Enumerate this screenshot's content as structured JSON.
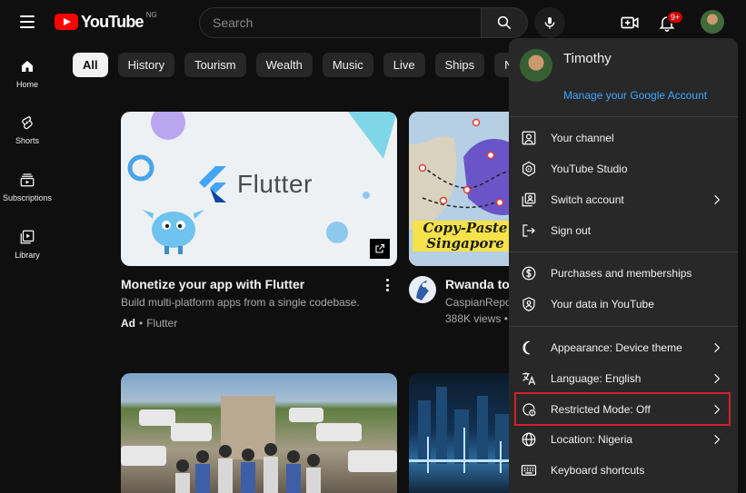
{
  "header": {
    "logo_text": "YouTube",
    "region": "NG",
    "search_placeholder": "Search",
    "notification_count": "9+"
  },
  "leftnav": [
    {
      "label": "Home",
      "icon": "home-icon"
    },
    {
      "label": "Shorts",
      "icon": "shorts-icon"
    },
    {
      "label": "Subscriptions",
      "icon": "subscriptions-icon"
    },
    {
      "label": "Library",
      "icon": "library-icon"
    }
  ],
  "chips": [
    "All",
    "History",
    "Tourism",
    "Wealth",
    "Music",
    "Live",
    "Ships",
    "News"
  ],
  "videos": [
    {
      "title": "Monetize your app with Flutter",
      "description": "Build multi-platform apps from a single codebase.",
      "ad_label": "Ad",
      "advertiser": "Flutter",
      "thumb_word": "Flutter"
    },
    {
      "title": "Rwanda to l",
      "channel": "CaspianRepo",
      "views": "388K views •",
      "thumb_caption": "Copy-Paste Singapore"
    }
  ],
  "account_menu": {
    "name": "Timothy",
    "manage_link": "Manage your Google Account",
    "groups": [
      [
        {
          "label": "Your channel",
          "icon": "account-box-icon",
          "chevron": false
        },
        {
          "label": "YouTube Studio",
          "icon": "studio-icon",
          "chevron": false
        },
        {
          "label": "Switch account",
          "icon": "switch-account-icon",
          "chevron": true
        },
        {
          "label": "Sign out",
          "icon": "sign-out-icon",
          "chevron": false
        }
      ],
      [
        {
          "label": "Purchases and memberships",
          "icon": "dollar-icon",
          "chevron": false
        },
        {
          "label": "Your data in YouTube",
          "icon": "shield-user-icon",
          "chevron": false
        }
      ],
      [
        {
          "label": "Appearance: Device theme",
          "icon": "moon-icon",
          "chevron": true
        },
        {
          "label": "Language: English",
          "icon": "translate-icon",
          "chevron": true
        },
        {
          "label": "Restricted Mode: Off",
          "icon": "restricted-mode-icon",
          "chevron": true
        },
        {
          "label": "Location: Nigeria",
          "icon": "globe-icon",
          "chevron": true
        },
        {
          "label": "Keyboard shortcuts",
          "icon": "keyboard-icon",
          "chevron": false
        }
      ]
    ]
  },
  "colors": {
    "background": "#0f0f0f",
    "menu_background": "#282828",
    "link_blue": "#3ea6ff",
    "brand_red": "#ff0000",
    "highlight_red": "#d21f2c"
  }
}
